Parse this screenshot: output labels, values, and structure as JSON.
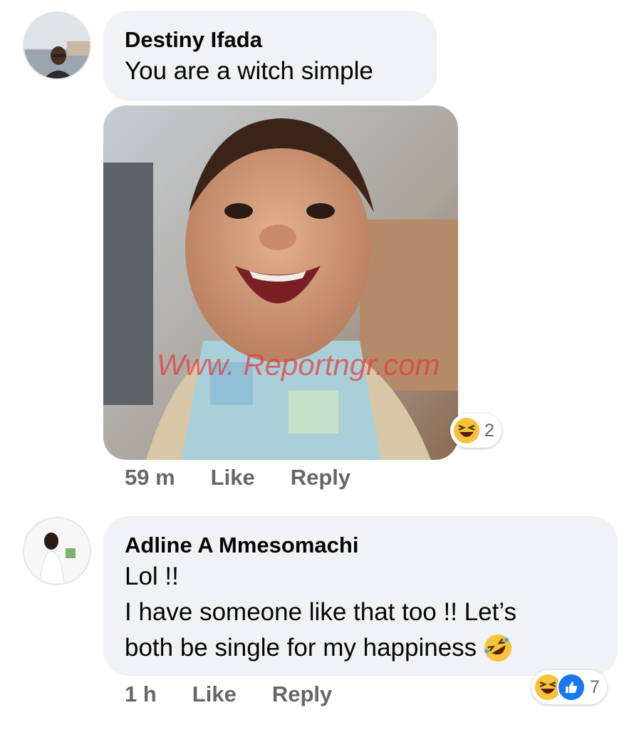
{
  "comments": [
    {
      "author": "Destiny Ifada",
      "text": "You are a witch simple",
      "image_watermark": "Www. Reportngr.com",
      "reactions_count": "2",
      "time": "59 m",
      "like_label": "Like",
      "reply_label": "Reply"
    },
    {
      "author": "Adline A Mmesomachi",
      "text_lines": [
        "Lol !!",
        "I have someone like that too !! Let’s",
        "both be single for my happiness"
      ],
      "reactions_count": "7",
      "time": "1 h",
      "like_label": "Like",
      "reply_label": "Reply"
    }
  ],
  "icons": {
    "haha": "laughing-squint-emoji",
    "rofl": "rolling-on-floor-laughing-emoji",
    "like": "thumbs-up-icon"
  },
  "colors": {
    "bubble": "#f0f2f5",
    "like_blue": "#1877f2",
    "meta_text": "#65676b",
    "watermark": "#e63c3c"
  }
}
